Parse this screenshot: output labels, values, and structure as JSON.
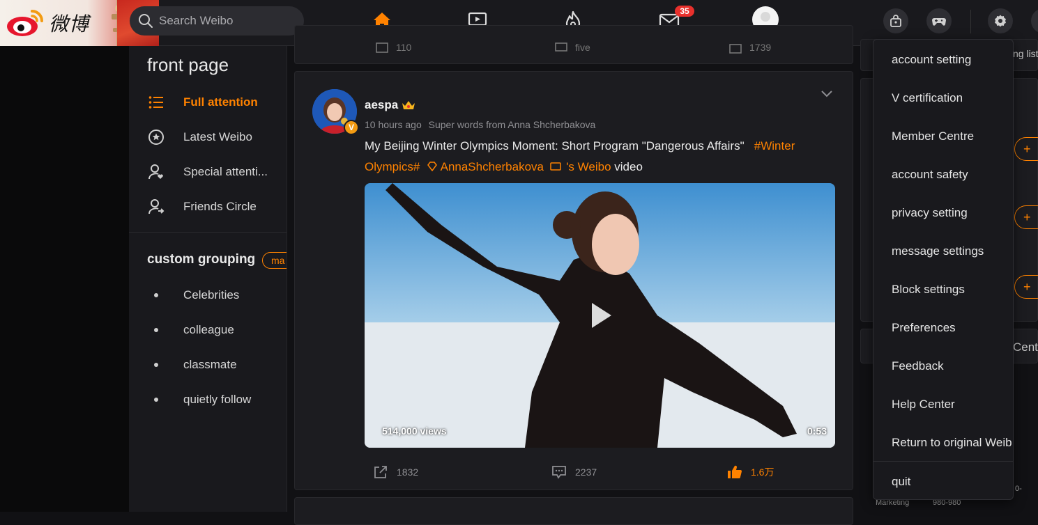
{
  "header": {
    "logo_text": "微博",
    "search_placeholder": "Search Weibo",
    "message_badge": "35"
  },
  "sidebar": {
    "title": "front page",
    "items": [
      {
        "label": "Full attention",
        "active": true,
        "icon": "list-icon"
      },
      {
        "label": "Latest Weibo",
        "active": false,
        "icon": "star-circle-icon"
      },
      {
        "label": "Special attenti...",
        "active": false,
        "icon": "user-heart-icon"
      },
      {
        "label": "Friends Circle",
        "active": false,
        "icon": "user-friends-icon"
      }
    ],
    "custom_grouping_title": "custom grouping",
    "manage_label": "ma",
    "groups": [
      "Celebrities",
      "colleague",
      "classmate",
      "quietly follow"
    ]
  },
  "prev_post": {
    "repost_count": "110",
    "comment_count": "five",
    "like_count": "1739"
  },
  "post": {
    "author": "aespa",
    "time": "10 hours ago",
    "source": "Super words from Anna Shcherbakova",
    "text_main": "My Beijing Winter Olympics Moment: Short Program \"Dangerous Affairs\"",
    "hashtag": "#Winter Olympics#",
    "mention": "AnnaShcherbakova",
    "weibo_link": "'s Weibo",
    "suffix": "video",
    "video_views": "514,000 views",
    "video_duration": "0:53",
    "repost_count": "1832",
    "comment_count": "2237",
    "like_count": "1.6万"
  },
  "right_panel": {
    "partial_top": "ng list",
    "partial_center": "Cente",
    "plus_label": "+",
    "bottom_left": "Marketing",
    "bottom_right": "980-980",
    "bottom_right_top": "0-"
  },
  "settings_menu": {
    "items": [
      "account setting",
      "V certification",
      "Member Centre",
      "account safety",
      "privacy setting",
      "message settings",
      "Block settings",
      "Preferences",
      "Feedback",
      "Help Center",
      "Return to original Weib",
      "quit"
    ]
  },
  "colors": {
    "accent": "#ff8200",
    "background": "#111114",
    "panel": "#19191d",
    "badge": "#e8302c"
  }
}
